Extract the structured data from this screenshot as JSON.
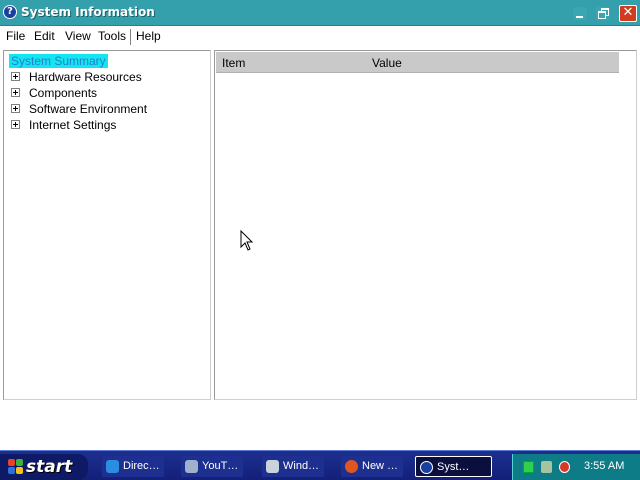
{
  "window": {
    "title": "System Information",
    "icon": "help-icon",
    "title_bar_color": "#34a0ac",
    "controls": [
      "minimize-icon",
      "restore-icon",
      "close-icon"
    ],
    "close_glyph": "✕"
  },
  "menu": {
    "items": [
      "File",
      "Edit",
      "View",
      "Tools",
      "Help"
    ]
  },
  "tree": {
    "root": "System Summary",
    "nodes": [
      "Hardware Resources",
      "Components",
      "Software Environment",
      "Internet Settings"
    ]
  },
  "list": {
    "columns": [
      "Item",
      "Value"
    ]
  },
  "taskbar": {
    "start_label": "start",
    "tasks": [
      {
        "label": "Direc…",
        "icon": "internet-explorer-icon",
        "active": false
      },
      {
        "label": "YouT…",
        "icon": "satellite-icon",
        "active": false
      },
      {
        "label": "Wind…",
        "icon": "computer-icon",
        "active": false
      },
      {
        "label": "New …",
        "icon": "firefox-icon",
        "active": false
      },
      {
        "label": "Syst…",
        "icon": "help-icon",
        "active": true
      }
    ],
    "tray_icons": [
      "network-icon",
      "safely-remove-hardware-icon",
      "security-alert-icon"
    ],
    "clock": "3:55 AM"
  }
}
